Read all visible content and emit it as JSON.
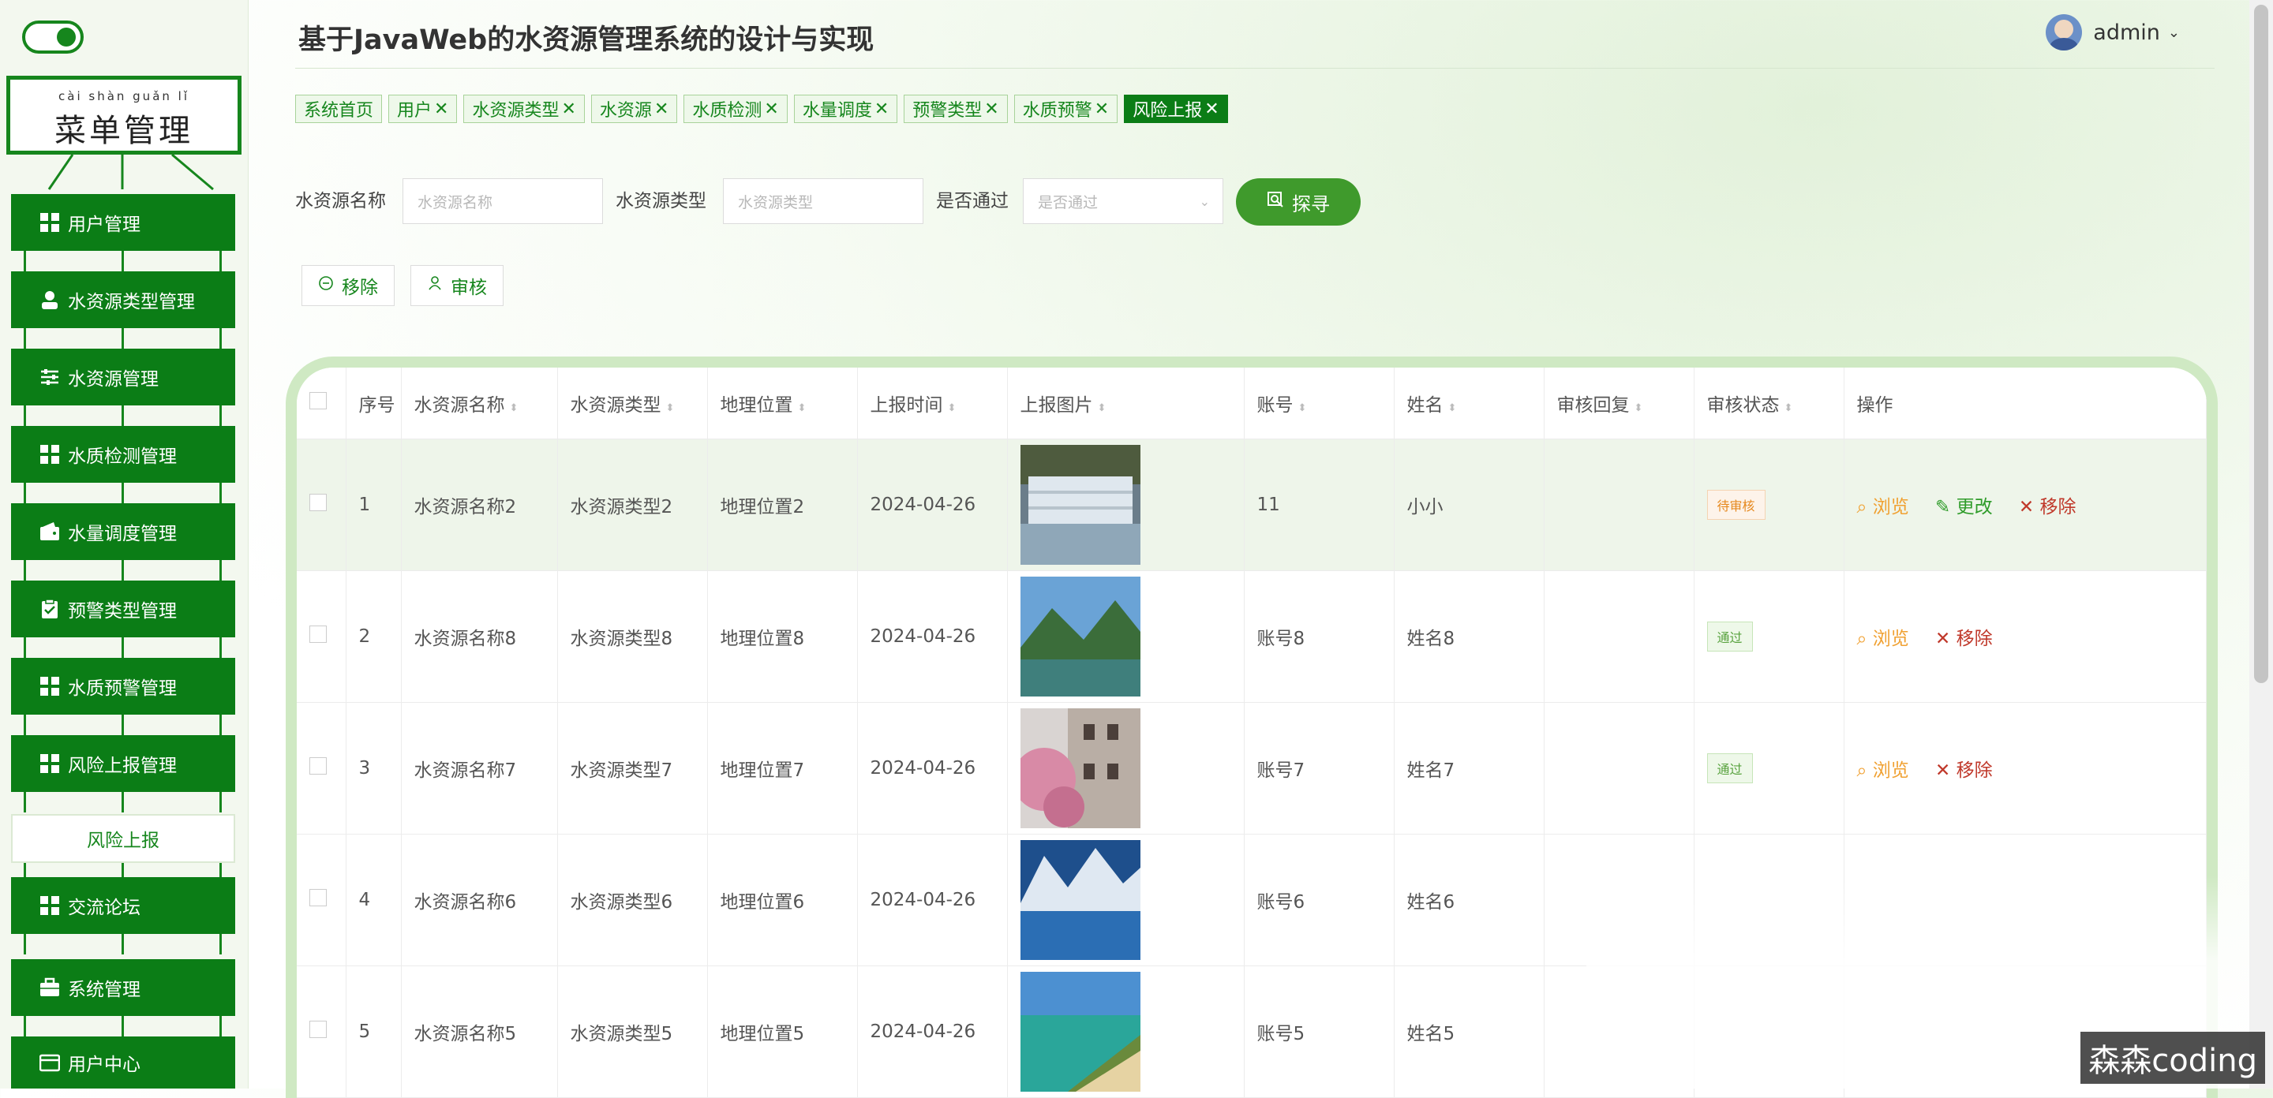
{
  "header": {
    "title": "基于JavaWeb的水资源管理系统的设计与实现",
    "username": "admin"
  },
  "sidebar": {
    "menu_title_pinyin": "cài shàn guǎn lǐ",
    "menu_title": "菜单管理",
    "items": [
      {
        "label": "用户管理",
        "icon": "grid-icon"
      },
      {
        "label": "水资源类型管理",
        "icon": "person-icon"
      },
      {
        "label": "水资源管理",
        "icon": "sliders-icon"
      },
      {
        "label": "水质检测管理",
        "icon": "grid-icon"
      },
      {
        "label": "水量调度管理",
        "icon": "wallet-icon"
      },
      {
        "label": "预警类型管理",
        "icon": "clipboard-check-icon"
      },
      {
        "label": "水质预警管理",
        "icon": "grid-icon"
      },
      {
        "label": "风险上报管理",
        "icon": "grid-icon"
      },
      {
        "label": "风险上报",
        "icon": ""
      },
      {
        "label": "交流论坛",
        "icon": "grid-icon"
      },
      {
        "label": "系统管理",
        "icon": "briefcase-icon"
      },
      {
        "label": "用户中心",
        "icon": "card-icon"
      }
    ]
  },
  "tabs": [
    {
      "label": "系统首页",
      "closable": false
    },
    {
      "label": "用户",
      "closable": true
    },
    {
      "label": "水资源类型",
      "closable": true
    },
    {
      "label": "水资源",
      "closable": true
    },
    {
      "label": "水质检测",
      "closable": true
    },
    {
      "label": "水量调度",
      "closable": true
    },
    {
      "label": "预警类型",
      "closable": true
    },
    {
      "label": "水质预警",
      "closable": true
    },
    {
      "label": "风险上报",
      "closable": true,
      "active": true
    }
  ],
  "filters": {
    "name_label": "水资源名称",
    "name_placeholder": "水资源名称",
    "type_label": "水资源类型",
    "type_placeholder": "水资源类型",
    "pass_label": "是否通过",
    "pass_placeholder": "是否通过",
    "search_label": "探寻"
  },
  "actions": {
    "remove_label": "移除",
    "review_label": "审核"
  },
  "table": {
    "columns": [
      "序号",
      "水资源名称",
      "水资源类型",
      "地理位置",
      "上报时间",
      "上报图片",
      "账号",
      "姓名",
      "审核回复",
      "审核状态",
      "操作"
    ],
    "rows": [
      {
        "no": "1",
        "name": "水资源名称2",
        "type": "水资源类型2",
        "location": "地理位置2",
        "time": "2024-04-26",
        "image": "waterfall",
        "account": "11",
        "person": "小小",
        "reply": "",
        "status": "待审核",
        "status_kind": "pending",
        "ops": [
          "浏览",
          "更改",
          "移除"
        ]
      },
      {
        "no": "2",
        "name": "水资源名称8",
        "type": "水资源类型8",
        "location": "地理位置8",
        "time": "2024-04-26",
        "image": "mountain-lake",
        "account": "账号8",
        "person": "姓名8",
        "reply": "",
        "status": "通过",
        "status_kind": "pass",
        "ops": [
          "浏览",
          "移除"
        ]
      },
      {
        "no": "3",
        "name": "水资源名称7",
        "type": "水资源类型7",
        "location": "地理位置7",
        "time": "2024-04-26",
        "image": "blossom-house",
        "account": "账号7",
        "person": "姓名7",
        "reply": "",
        "status": "通过",
        "status_kind": "pass",
        "ops": [
          "浏览",
          "移除"
        ]
      },
      {
        "no": "4",
        "name": "水资源名称6",
        "type": "水资源类型6",
        "location": "地理位置6",
        "time": "2024-04-26",
        "image": "snow-mountain",
        "account": "账号6",
        "person": "姓名6",
        "reply": "",
        "status": "",
        "status_kind": "pass",
        "ops": []
      },
      {
        "no": "5",
        "name": "水资源名称5",
        "type": "水资源类型5",
        "location": "地理位置5",
        "time": "2024-04-26",
        "image": "coast",
        "account": "账号5",
        "person": "姓名5",
        "reply": "",
        "status": "",
        "status_kind": "pass",
        "ops": []
      }
    ]
  },
  "watermark": "森森coding",
  "colors": {
    "brand": "#0b7d16",
    "accent": "#3f9a2c",
    "pending": "#e6891f",
    "remove": "#c0392b"
  }
}
